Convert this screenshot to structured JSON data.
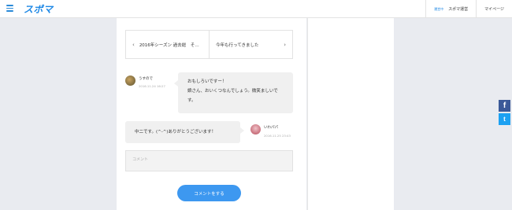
{
  "header": {
    "logo": "スポマ",
    "user_role": "運営中",
    "user_name": "スポマ運営",
    "mypage": "マイページ"
  },
  "pager": {
    "prev_label": "2016年シーズン 過去総　そ…",
    "next_label": "今年も行ってきました",
    "prev_arrow": "‹",
    "next_arrow": "›"
  },
  "comments": [
    {
      "author": "うすので",
      "date": "2016.11.24 16:27",
      "text_line1": "おもしろいですー！",
      "text_line2": "娘さん、おいくつなんでしょう。微笑ましいで",
      "text_line3": "す。"
    },
    {
      "author": "いわパパ",
      "date": "2016.11.25 23:43",
      "text_line1": "中二です。(^-^)ありがとうございます！"
    }
  ],
  "form": {
    "placeholder": "コメント",
    "submit_label": "コメントをする"
  },
  "social": {
    "facebook": "f",
    "twitter": "t"
  }
}
